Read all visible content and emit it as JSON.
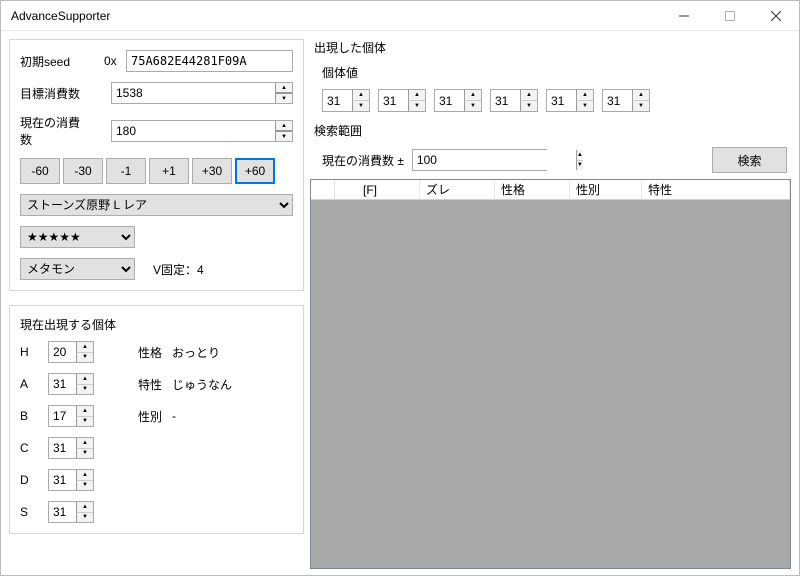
{
  "window": {
    "title": "AdvanceSupporter"
  },
  "left": {
    "seed_label": "初期seed",
    "seed_prefix": "0x",
    "seed_value": "75A682E44281F09A",
    "target_label": "目標消費数",
    "target_value": "1538",
    "current_label": "現在の消費数",
    "current_value": "180",
    "btns": {
      "m60": "-60",
      "m30": "-30",
      "m1": "-1",
      "p1": "+1",
      "p30": "+30",
      "p60": "+60"
    },
    "den_options": [
      "ストーンズ原野 L レア"
    ],
    "star_options": [
      "★★★★★"
    ],
    "species_options": [
      "メタモン"
    ],
    "fixed_v_label": "V固定：4"
  },
  "current": {
    "title": "現在出現する個体",
    "stats": {
      "H": "20",
      "A": "31",
      "B": "17",
      "C": "31",
      "D": "31",
      "S": "31"
    },
    "nature_label": "性格",
    "nature_value": "おっとり",
    "ability_label": "特性",
    "ability_value": "じゅうなん",
    "gender_label": "性別",
    "gender_value": "-"
  },
  "right": {
    "title": "出現した個体",
    "ivs_label": "個体値",
    "ivs": [
      "31",
      "31",
      "31",
      "31",
      "31",
      "31"
    ],
    "range_label": "検索範囲",
    "range_current_label": "現在の消費数 ±",
    "range_value": "100",
    "search_btn": "検索",
    "columns": {
      "c1": "[F]",
      "c2": "ズレ",
      "c3": "性格",
      "c4": "性別",
      "c5": "特性"
    }
  }
}
